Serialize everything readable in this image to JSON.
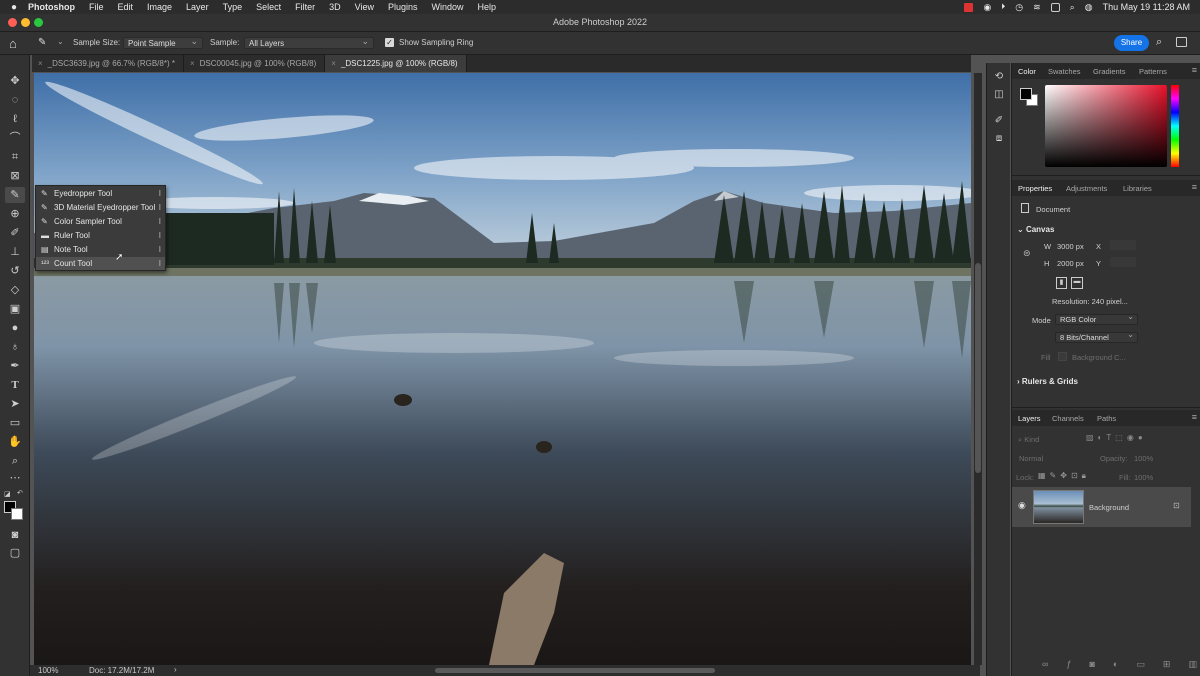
{
  "menubar": {
    "apple": "",
    "items": [
      "Photoshop",
      "File",
      "Edit",
      "Image",
      "Layer",
      "Type",
      "Select",
      "Filter",
      "3D",
      "View",
      "Plugins",
      "Window",
      "Help"
    ],
    "clock": "Thu May 19  11:28 AM"
  },
  "window": {
    "title": "Adobe Photoshop 2022"
  },
  "options": {
    "sample_size_label": "Sample Size:",
    "sample_size_value": "Point Sample",
    "sample_label": "Sample:",
    "sample_value": "All Layers",
    "sampling_ring_label": "Show Sampling Ring",
    "sampling_ring_checked": true,
    "share_label": "Share"
  },
  "tabs": [
    {
      "label": "_DSC3639.jpg @ 66.7% (RGB/8*) *"
    },
    {
      "label": "DSC00045.jpg @ 100% (RGB/8)"
    },
    {
      "label": "_DSC1225.jpg @ 100% (RGB/8)",
      "active": true
    }
  ],
  "flyout": {
    "items": [
      {
        "label": "Eyedropper Tool",
        "icon": "eyedropper-icon",
        "shortcut": "I"
      },
      {
        "label": "3D Material Eyedropper Tool",
        "icon": "3d-eyedropper-icon",
        "shortcut": "I"
      },
      {
        "label": "Color Sampler Tool",
        "icon": "color-sampler-icon",
        "shortcut": "I"
      },
      {
        "label": "Ruler Tool",
        "icon": "ruler-icon",
        "shortcut": "I"
      },
      {
        "label": "Note Tool",
        "icon": "note-icon",
        "shortcut": "I"
      },
      {
        "label": "Count Tool",
        "icon": "count-icon",
        "shortcut": "I",
        "highlighted": true
      }
    ]
  },
  "status": {
    "zoom": "100%",
    "doc": "Doc: 17.2M/17.2M",
    "arrow": "›"
  },
  "color_panel": {
    "tabs": [
      "Color",
      "Swatches",
      "Gradients",
      "Patterns"
    ],
    "active": "Color",
    "foreground": "#000000",
    "background": "#ffffff",
    "hue_color": "#e8102a"
  },
  "properties_panel": {
    "tabs": [
      "Properties",
      "Adjustments",
      "Libraries"
    ],
    "active": "Properties",
    "doc_label": "Document",
    "canvas_section": "Canvas",
    "w_label": "W",
    "w_value": "3000 px",
    "h_label": "H",
    "h_value": "2000 px",
    "x_label": "X",
    "y_label": "Y",
    "resolution": "Resolution: 240 pixel...",
    "mode_label": "Mode",
    "mode_value": "RGB Color",
    "bits_value": "8 Bits/Channel",
    "fill_label": "Fill",
    "fill_value": "Background C...",
    "rulers_section": "Rulers & Grids"
  },
  "layers_panel": {
    "tabs": [
      "Layers",
      "Channels",
      "Paths"
    ],
    "active": "Layers",
    "kind_label": "Kind",
    "blend_mode": "Normal",
    "opacity_label": "Opacity:",
    "opacity_value": "100%",
    "lock_label": "Lock:",
    "fill_label": "Fill:",
    "fill_value": "100%",
    "layer_name": "Background"
  }
}
